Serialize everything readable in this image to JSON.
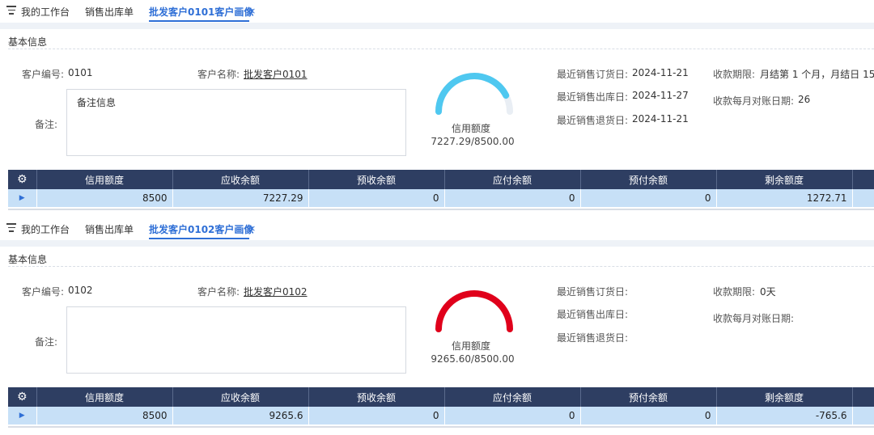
{
  "panels": [
    {
      "tabs": {
        "workbench": "我的工作台",
        "sales_outbound": "销售出库单",
        "active": "批发客户0101客户画像",
        "close": "×"
      },
      "section_title": "基本信息",
      "customer_code_label": "客户编号:",
      "customer_code": "0101",
      "customer_name_label": "客户名称:",
      "customer_name": "批发客户0101",
      "remark_label": "备注:",
      "remark_value": "备注信息",
      "gauge": {
        "label": "信用额度",
        "value_text": "7227.29/8500.00",
        "used": 7227.29,
        "limit": 8500.0,
        "color": "#4fc8f0"
      },
      "last_order_label": "最近销售订货日:",
      "last_order": "2024-11-21",
      "last_outbound_label": "最近销售出库日:",
      "last_outbound": "2024-11-27",
      "last_return_label": "最近销售退货日:",
      "last_return": "2024-11-21",
      "payment_term_label": "收款期限:",
      "payment_term": "月结第 1 个月，月结日 15",
      "reconcile_label": "收款每月对账日期:",
      "reconcile_day": "26",
      "table": {
        "headers": [
          "信用额度",
          "应收余额",
          "预收余额",
          "应付余额",
          "预付余额",
          "剩余额度"
        ],
        "row": [
          "8500",
          "7227.29",
          "0",
          "0",
          "0",
          "1272.71"
        ]
      }
    },
    {
      "tabs": {
        "workbench": "我的工作台",
        "sales_outbound": "销售出库单",
        "active": "批发客户0102客户画像",
        "close": "×"
      },
      "section_title": "基本信息",
      "customer_code_label": "客户编号:",
      "customer_code": "0102",
      "customer_name_label": "客户名称:",
      "customer_name": "批发客户0102",
      "remark_label": "备注:",
      "remark_value": "",
      "gauge": {
        "label": "信用额度",
        "value_text": "9265.60/8500.00",
        "used": 9265.6,
        "limit": 8500.0,
        "color": "#e0001b"
      },
      "last_order_label": "最近销售订货日:",
      "last_order": "",
      "last_outbound_label": "最近销售出库日:",
      "last_outbound": "",
      "last_return_label": "最近销售退货日:",
      "last_return": "",
      "payment_term_label": "收款期限:",
      "payment_term": "0天",
      "reconcile_label": "收款每月对账日期:",
      "reconcile_day": "",
      "table": {
        "headers": [
          "信用额度",
          "应收余额",
          "预收余额",
          "应付余额",
          "预付余额",
          "剩余额度"
        ],
        "row": [
          "8500",
          "9265.6",
          "0",
          "0",
          "0",
          "-765.6"
        ]
      }
    }
  ]
}
